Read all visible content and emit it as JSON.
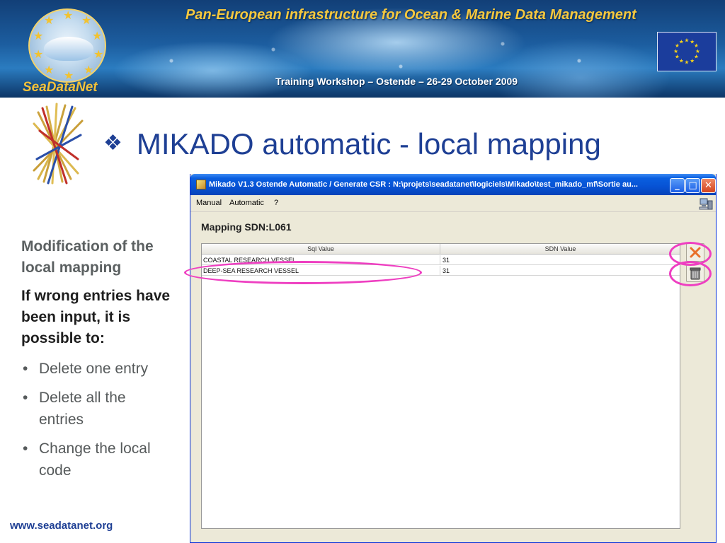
{
  "banner": {
    "title": "Pan-European infrastructure for Ocean & Marine Data Management",
    "subtitle": "Training Workshop – Ostende – 26-29 October 2009",
    "brand": "SeaDataNet"
  },
  "slide": {
    "title": "MIKADO automatic  - local mapping",
    "bullet_symbol": "❖"
  },
  "left": {
    "heading_modification": "Modification of the local mapping",
    "heading_wrong": "If wrong entries have been input, it is possible to:",
    "bullets": [
      "Delete one entry",
      "Delete all the entries",
      "Change the local code"
    ]
  },
  "footer": {
    "url": "www.seadatanet.org"
  },
  "app": {
    "window_title": "Mikado V1.3 Ostende      Automatic / Generate CSR : N:\\projets\\seadatanet\\logiciels\\Mikado\\test_mikado_mf\\Sortie au...",
    "menu": [
      "Manual",
      "Automatic",
      "?"
    ],
    "panel_title": "Mapping SDN:L061",
    "columns": [
      "Sql Value",
      "SDN Value"
    ],
    "rows": [
      [
        "COASTAL RESEARCH VESSEL",
        "31"
      ],
      [
        "DEEP-SEA RESEARCH VESSEL",
        "31"
      ]
    ],
    "icons": {
      "window": "mikado-app-icon",
      "tool": "network-computer-icon",
      "delete_entry": "delete-x-icon",
      "delete_all": "trash-can-icon"
    }
  },
  "colors": {
    "title_blue": "#1e3f94",
    "banner_gold": "#f6c83e",
    "highlight_pink": "#ee3fc1",
    "xp_titlebar": "#0752d4"
  }
}
